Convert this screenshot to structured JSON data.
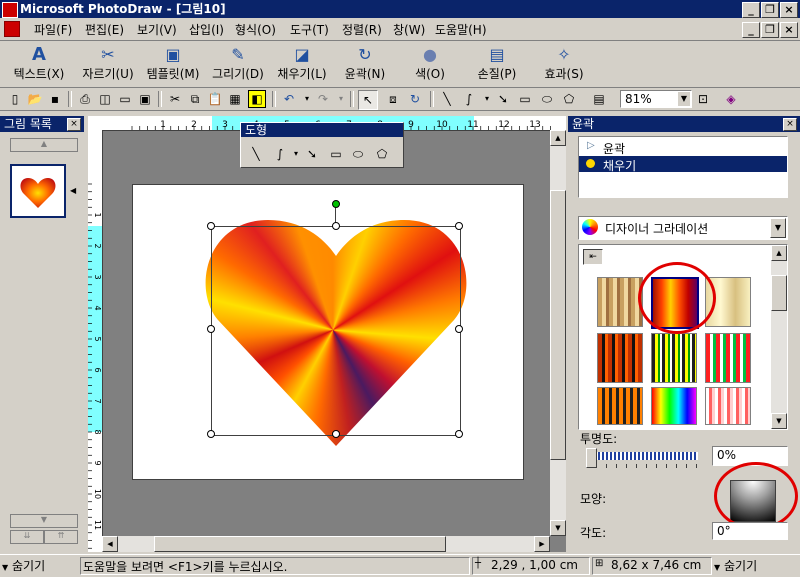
{
  "window": {
    "title": "Microsoft PhotoDraw - [그림10]"
  },
  "menu": [
    "파일(F)",
    "편집(E)",
    "보기(V)",
    "삽입(I)",
    "형식(O)",
    "도구(T)",
    "정렬(R)",
    "창(W)",
    "도움말(H)"
  ],
  "bigbar": {
    "text": "텍스트(X)",
    "cut": "자르기(U)",
    "template": "템플릿(M)",
    "draw": "그리기(D)",
    "fill": "채우기(L)",
    "outline": "윤곽(N)",
    "color": "색(O)",
    "touchup": "손질(P)",
    "effects": "효과(S)"
  },
  "standard": {
    "zoom": "81%"
  },
  "picture_list": {
    "title": "그림 목록"
  },
  "shape_toolbar": {
    "title": "도형"
  },
  "ruler": {
    "h_labels": [
      "1",
      "2",
      "3",
      "4",
      "5",
      "6",
      "7",
      "8",
      "9",
      "10",
      "11",
      "12",
      "13"
    ],
    "v_labels": [
      "1",
      "2",
      "3",
      "4",
      "5",
      "6",
      "7",
      "8",
      "9",
      "10",
      "11"
    ]
  },
  "right_panel": {
    "title": "윤곽",
    "list": [
      "윤곽",
      "채우기"
    ],
    "fill_type": "디자이너 그라데이션",
    "transparency_label": "투명도:",
    "transparency_value": "0%",
    "shape_label": "모양:",
    "angle_label": "각도:",
    "angle_value": "0°"
  },
  "status": {
    "hide_left": "숨기기",
    "help": "도움말을 보려면 <F1>키를 누르십시오.",
    "position": "2,29 , 1,00 cm",
    "size": "8,62 x 7,46 cm",
    "hide_right": "숨기기"
  },
  "colors": {
    "title_bg": "#0a246a",
    "face": "#d4d0c8",
    "annotation": "#e00000",
    "ruler_highlight": "#80ffff"
  }
}
